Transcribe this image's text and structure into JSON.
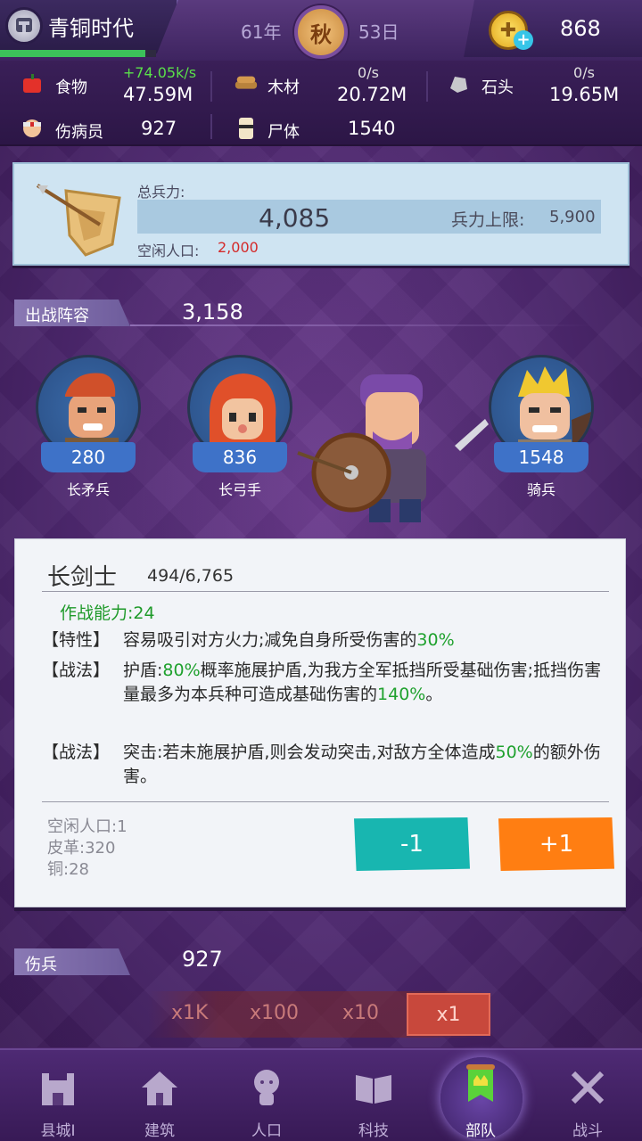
{
  "header": {
    "era_name": "青铜时代",
    "year": "61年",
    "season": "秋",
    "day": "53日",
    "coins": "868",
    "era_progress": 0.93
  },
  "resources": {
    "food": {
      "label": "食物",
      "rate": "+74.05k/s",
      "value": "47.59M"
    },
    "wood": {
      "label": "木材",
      "rate": "0/s",
      "value": "20.72M"
    },
    "stone": {
      "label": "石头",
      "rate": "0/s",
      "value": "19.65M"
    },
    "wounded": {
      "label": "伤病员",
      "value": "927"
    },
    "corpses": {
      "label": "尸体",
      "value": "1540"
    }
  },
  "troops": {
    "total_label": "总兵力:",
    "total": "4,085",
    "limit_label": "兵力上限:",
    "limit": "5,900",
    "idle_label": "空闲人口:",
    "idle": "2,000"
  },
  "lineup": {
    "label": "出战阵容",
    "value": "3,158",
    "units": [
      {
        "name": "长矛兵",
        "count": "280"
      },
      {
        "name": "长弓手",
        "count": "836"
      },
      {
        "name": "骑兵",
        "count": "1548"
      }
    ]
  },
  "card": {
    "name": "长剑士",
    "count": "494/6,765",
    "power": "作战能力:24",
    "trait_tag": "【特性】",
    "trait_text": "容易吸引对方火力;减免自身所受伤害的",
    "trait_pct": "30%",
    "skill1_tag": "【战法】",
    "skill1_a": "护盾:",
    "skill1_pct": "80%",
    "skill1_b": "概率施展护盾,为我方全军抵挡所受基础伤害;抵挡伤害量最多为本兵种可造成基础伤害的",
    "skill1_pct2": "140%",
    "skill1_c": "。",
    "skill2_tag": "【战法】",
    "skill2_a": "突击:若未施展护盾,则会发动突击,对敌方全体造成",
    "skill2_pct": "50%",
    "skill2_b": "的额外伤害。",
    "cost_idle": "空闲人口:1",
    "cost_leather": "皮革:320",
    "cost_copper": "铜:28",
    "minus_label": "-1",
    "plus_label": "+1"
  },
  "wounded_section": {
    "label": "伤兵",
    "value": "927"
  },
  "multipliers": [
    "x1K",
    "x100",
    "x10",
    "x1"
  ],
  "nav": [
    {
      "label": "县城I"
    },
    {
      "label": "建筑"
    },
    {
      "label": "人口"
    },
    {
      "label": "科技"
    },
    {
      "label": "部队"
    },
    {
      "label": "战斗"
    }
  ]
}
